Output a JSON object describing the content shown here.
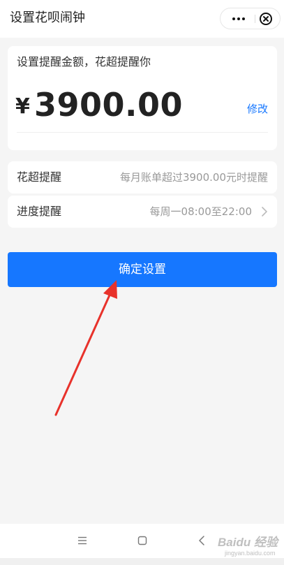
{
  "header": {
    "title": "设置花呗闹钟",
    "more_icon": "more-dots-icon",
    "close_icon": "close-circle-icon"
  },
  "amount_card": {
    "prompt": "设置提醒金额，花超提醒你",
    "currency_symbol": "¥",
    "amount": "3900.00",
    "modify_label": "修改"
  },
  "rows": [
    {
      "label": "花超提醒",
      "value": "每月账单超过3900.00元时提醒"
    },
    {
      "label": "进度提醒",
      "value": "每周一08:00至22:00",
      "icon": "chevron-right-icon"
    }
  ],
  "confirm_button": {
    "label": "确定设置"
  },
  "system_nav": {
    "menu_icon": "menu-icon",
    "home_icon": "home-icon",
    "back_icon": "back-icon"
  },
  "watermark": {
    "text": "Baidu 经验",
    "sub": "jingyan.baidu.com"
  },
  "colors": {
    "accent": "#1677ff",
    "background": "#f5f5f5",
    "annotation_arrow": "#e8322b"
  }
}
